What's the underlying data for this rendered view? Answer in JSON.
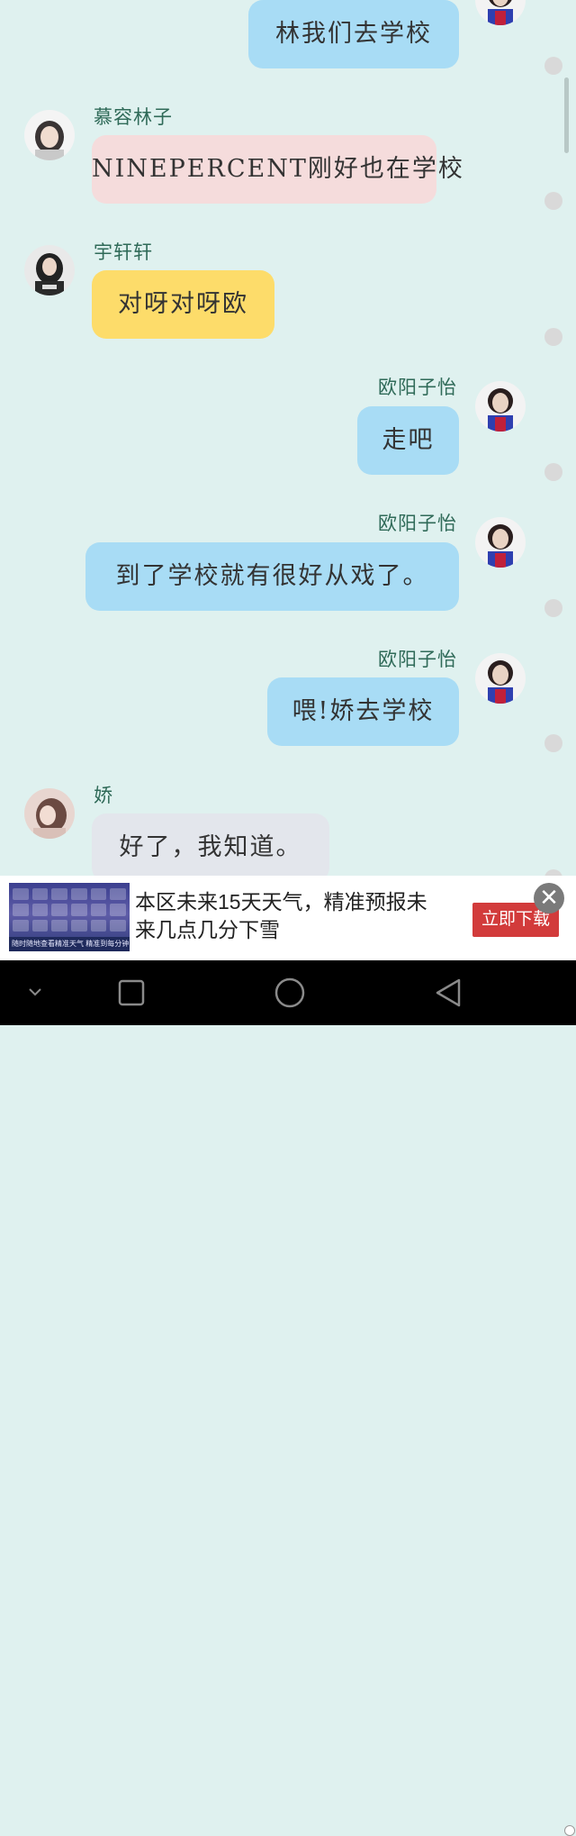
{
  "messages": [
    {
      "side": "right",
      "name": "",
      "text": "林我们去学校",
      "bubble_color": "#a8dcf5"
    },
    {
      "side": "left",
      "name": "慕容林子",
      "text": "NINEPERCENT刚好也在学校",
      "bubble_color": "#f5dcdc"
    },
    {
      "side": "left",
      "name": "宇轩轩",
      "text": "对呀对呀欧",
      "bubble_color": "#fddc6a"
    },
    {
      "side": "right",
      "name": "欧阳子怡",
      "text": "走吧",
      "bubble_color": "#a8dcf5"
    },
    {
      "side": "right",
      "name": "欧阳子怡",
      "text": "到了学校就有很好从戏了。",
      "bubble_color": "#a8dcf5"
    },
    {
      "side": "right",
      "name": "欧阳子怡",
      "text": "喂!娇去学校",
      "bubble_color": "#a8dcf5"
    },
    {
      "side": "left",
      "name": "娇",
      "text": "好了，我知道。",
      "bubble_color": "#e3e6ec"
    }
  ],
  "ad": {
    "text": "本区未来15天天气，精准预报未来几点几分下雪",
    "button": "立即下载",
    "image_caption": "随时随地查看精准天气  精准到每分钟"
  },
  "colors": {
    "background": "#dff1ef",
    "name": "#2f6a58",
    "ad_button": "#d23b3b"
  },
  "icons": {
    "ad_close": "close-icon",
    "nav_down": "chevron-down-icon",
    "nav_recent": "square-icon",
    "nav_home": "circle-icon",
    "nav_back": "triangle-back-icon"
  }
}
